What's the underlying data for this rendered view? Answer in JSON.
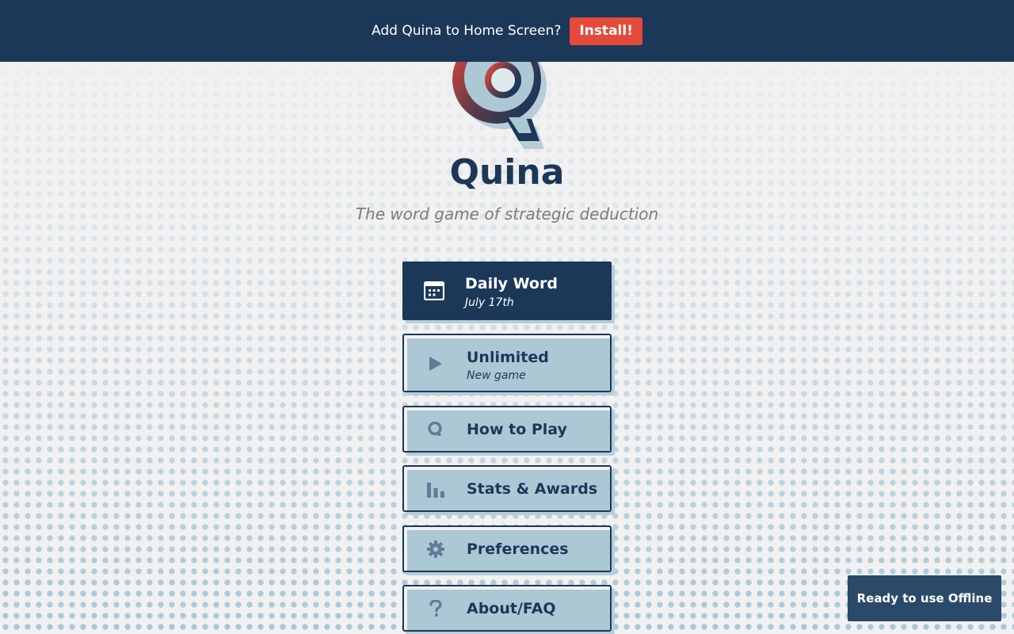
{
  "install_banner": {
    "text": "Add Quina to Home Screen?",
    "button_label": "Install!"
  },
  "app": {
    "title": "Quina",
    "tagline": "The word game of strategic deduction"
  },
  "menu": {
    "items": [
      {
        "label": "Daily Word",
        "sublabel": "July 17th",
        "icon": "calendar-icon"
      },
      {
        "label": "Unlimited",
        "sublabel": "New game",
        "icon": "play-icon"
      },
      {
        "label": "How to Play",
        "icon": "q-logo-icon"
      },
      {
        "label": "Stats & Awards",
        "icon": "bar-chart-icon"
      },
      {
        "label": "Preferences",
        "icon": "gear-icon"
      },
      {
        "label": "About/FAQ",
        "icon": "question-mark-icon"
      }
    ]
  },
  "toast": {
    "text": "Ready to use Offline"
  },
  "colors": {
    "navy": "#1b3858",
    "accent_red": "#e5493a",
    "light_blue": "#adc8d5"
  }
}
